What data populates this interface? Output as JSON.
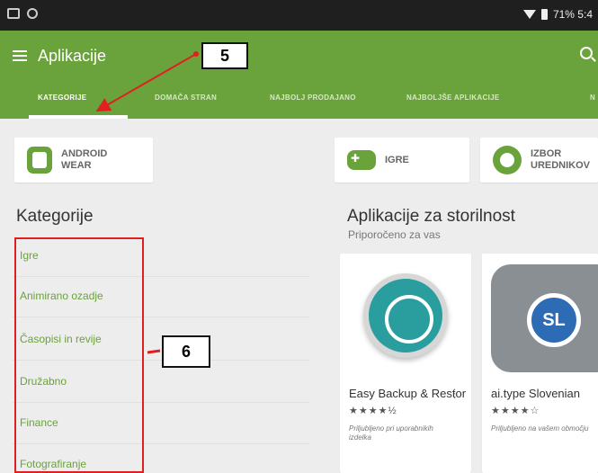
{
  "statusbar": {
    "battery_text": "71% 5:4"
  },
  "appbar": {
    "title": "Aplikacije"
  },
  "tabs": [
    {
      "label": "KATEGORIJE"
    },
    {
      "label": "DOMAČA STRAN"
    },
    {
      "label": "NAJBOLJ PRODAJANO"
    },
    {
      "label": "NAJBOLJŠE APLIKACIJE"
    },
    {
      "label": "N"
    }
  ],
  "callouts": {
    "five": "5",
    "six": "6"
  },
  "chips": [
    {
      "label": "ANDROID WEAR",
      "icon": "watch-icon"
    },
    {
      "label": "IGRE",
      "icon": "gamepad-icon"
    },
    {
      "label": "IZBOR UREDNIKOV",
      "icon": "editors-choice-icon"
    }
  ],
  "categories": {
    "title": "Kategorije",
    "items": [
      "Igre",
      "Animirano ozadje",
      "Časopisi in revije",
      "Družabno",
      "Finance",
      "Fotografiranje"
    ]
  },
  "productivity": {
    "title": "Aplikacije za storilnost",
    "subtitle": "Priporočeno za vas",
    "apps": [
      {
        "name": "Easy Backup & Restore",
        "stars": "★★★★½",
        "note": "Priljubljeno pri uporabnikih izdelka"
      },
      {
        "name": "ai.type Slovenian",
        "stars": "★★★★☆",
        "note": "Priljubljeno na vašem območju",
        "badge": "SL"
      }
    ]
  },
  "colors": {
    "accent": "#6aa23b",
    "annotation_red": "#e02020"
  }
}
